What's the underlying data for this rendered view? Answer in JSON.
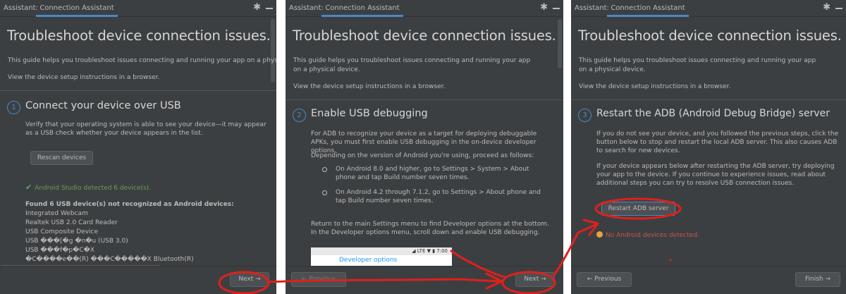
{
  "common": {
    "assistant_label": "Assistant:",
    "tab_label": "Connection Assistant",
    "title": "Troubleshoot device connection issues.",
    "view_link": "View the device setup instructions in a browser."
  },
  "panel1": {
    "intro": "This guide helps you troubleshoot issues connecting and running your app on a physical",
    "step_number": "1",
    "step_title": "Connect your device over USB",
    "step_text": "Verify that your operating system is able to see your device—it may appear as a USB check whether your device appears in the list.",
    "rescan_label": "Rescan devices",
    "detected_text": "Android Studio detected 6 device(s).",
    "not_recognized_heading": "Found 6 USB device(s) not recognized as Android devices:",
    "devices": [
      "Integrated Webcam",
      "Realtek USB 2.0 Card Reader",
      "USB Composite Device",
      "USB ���[�g �n�u (USB 3.0)",
      "USB ���f�p�C�X",
      "�C����e��(R) ���C�����X Bluetooth(R)"
    ],
    "next_label": "Next →"
  },
  "panel2": {
    "intro": "This guide helps you troubleshoot issues connecting and running your app on a physical device.",
    "step_number": "2",
    "step_title": "Enable USB debugging",
    "step_text": "For ADB to recognize your device as a target for deploying debuggable APKs, you must first enable USB debugging in the on-device developer options.",
    "version_text": "Depending on the version of Android you're using, proceed as follows:",
    "bullets": [
      "On Android 8.0 and higher, go to Settings > System > About phone and tap Build number seven times.",
      "On Android 4.2 through 7.1.2, go to Settings > About phone and tap Build number seven times."
    ],
    "return_text": "Return to the main Settings menu to find Developer options at the bottom. In the Developer options menu, scroll down and enable USB debugging.",
    "shot_status": "◢ LTE ▼ ▮ 7:00",
    "shot_title": "Developer options",
    "previous_label": "← Previous",
    "next_label": "Next →"
  },
  "panel3": {
    "intro": "This guide helps you troubleshoot issues connecting and running your app on a physical device.",
    "step_number": "3",
    "step_title": "Restart the ADB (Android Debug Bridge) server",
    "step_text_1": "If you do not see your device, and you followed the previous steps, click the button below to stop and restart the local ADB server. This also causes ADB to search for new devices.",
    "step_text_2": "If your device appears below after restarting the ADB server, try deploying your app to the device. If you continue to experience issues, read about additional steps you can try to resolve USB connection issues.",
    "restart_label": "Restart ADB server",
    "warning_text": "No Android devices detected.",
    "previous_label": "← Previous",
    "finish_label": "Finish →"
  },
  "colors": {
    "panel_bg": "#3c3f41",
    "accent": "#4a88c7",
    "annotation": "#e0201b",
    "success": "#59a869",
    "error": "#c75450"
  },
  "icons": [
    "gear-icon",
    "minimize-icon",
    "check-icon",
    "warning-icon",
    "arrow-right-icon",
    "arrow-left-icon"
  ]
}
